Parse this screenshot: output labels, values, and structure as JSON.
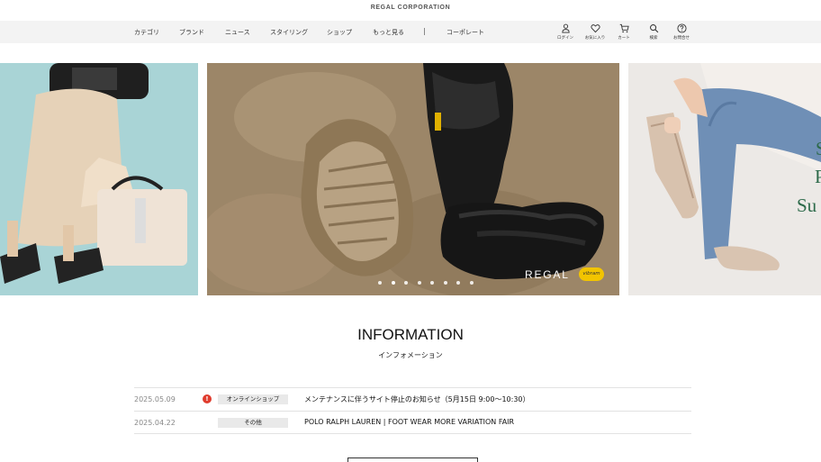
{
  "header": {
    "corp_name": "REGAL CORPORATION"
  },
  "nav": {
    "items": [
      "カテゴリ",
      "ブランド",
      "ニュース",
      "スタイリング",
      "ショップ",
      "もっと見る"
    ],
    "separator": "|",
    "corporate": "コーポレート"
  },
  "utility": [
    {
      "label": "ログイン",
      "icon": "user-icon"
    },
    {
      "label": "お気に入り",
      "icon": "heart-icon"
    },
    {
      "label": "カート",
      "icon": "cart-icon"
    },
    {
      "label": "検索",
      "icon": "search-icon"
    },
    {
      "label": "お問合せ",
      "icon": "question-icon"
    }
  ],
  "slider": {
    "brand_mark": "REGAL",
    "badge_text": "vibram",
    "right_text_lines": [
      "S",
      "P",
      "Su"
    ],
    "dot_count": 8,
    "active_dot": 1
  },
  "information": {
    "title": "INFORMATION",
    "subtitle": "インフォメーション",
    "items": [
      {
        "date": "2025.05.09",
        "alert": "!",
        "tag": "オンラインショップ",
        "text": "メンテナンスに伴うサイト停止のお知らせ（5月15日 9:00〜10:30）"
      },
      {
        "date": "2025.04.22",
        "tag": "その他",
        "text": "POLO RALPH LAUREN | FOOT WEAR MORE VARIATION FAIR"
      }
    ]
  },
  "colors": {
    "nav_bg": "#f3f3f3",
    "alert": "#e03c2e",
    "tag_bg": "#e9e9e9",
    "right_text": "#2d6a4a"
  }
}
